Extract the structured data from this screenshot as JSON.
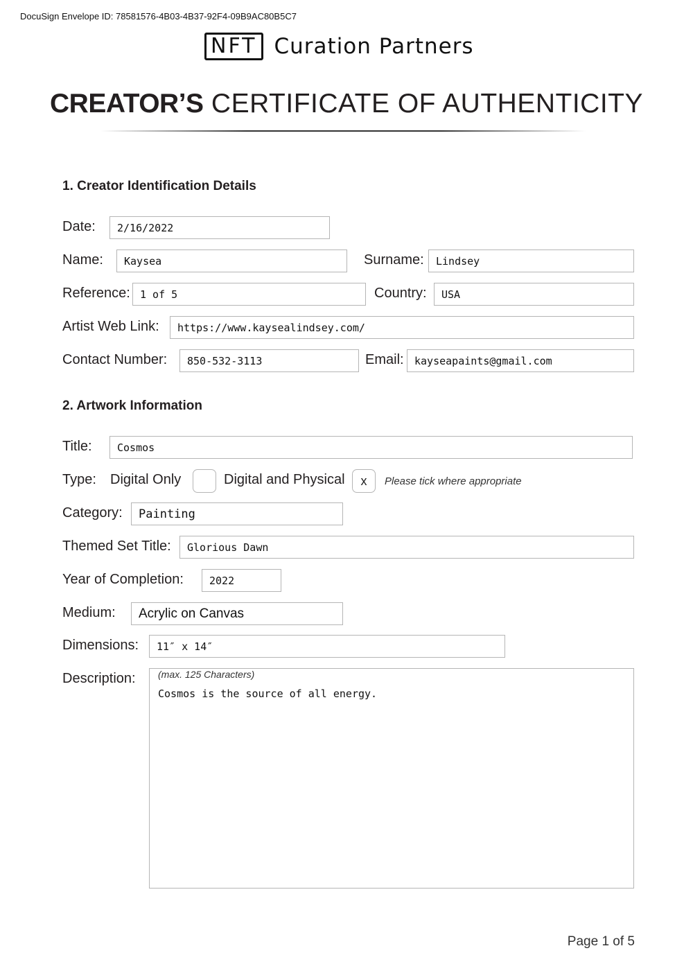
{
  "envelope_id": "DocuSign Envelope ID: 78581576-4B03-4B37-92F4-09B9AC80B5C7",
  "brand": {
    "logo_box_text": "NFT",
    "logo_text": "Curation Partners"
  },
  "certificate": {
    "title_bold": "CREATOR’S",
    "title_rest": "CERTIFICATE OF AUTHENTICITY"
  },
  "section1": {
    "heading": "1. Creator Identification Details",
    "date": {
      "label": "Date:",
      "value": "2/16/2022"
    },
    "name": {
      "label": "Name:",
      "value": "Kaysea"
    },
    "surname": {
      "label": "Surname:",
      "value": "Lindsey"
    },
    "reference": {
      "label": "Reference:",
      "value": "1 of 5"
    },
    "country": {
      "label": "Country:",
      "value": "USA"
    },
    "web_link": {
      "label": "Artist Web Link:",
      "value": "https://www.kaysealindsey.com/"
    },
    "contact": {
      "label": "Contact Number:",
      "value": "850-532-3113"
    },
    "email": {
      "label": "Email:",
      "value": "kayseapaints@gmail.com"
    }
  },
  "section2": {
    "heading": "2. Artwork Information",
    "title": {
      "label": "Title:",
      "value": "Cosmos"
    },
    "type": {
      "label": "Type:",
      "options": [
        {
          "label": "Digital Only",
          "mark": ""
        },
        {
          "label": "Digital and Physical",
          "mark": "x"
        }
      ],
      "hint": "Please tick where appropriate"
    },
    "category": {
      "label": "Category:",
      "value": "Painting"
    },
    "themed_set": {
      "label": "Themed Set Title:",
      "value": "Glorious Dawn"
    },
    "year": {
      "label": "Year of Completion:",
      "value": "2022"
    },
    "medium": {
      "label": "Medium:",
      "value": "Acrylic on Canvas"
    },
    "dimensions": {
      "label": "Dimensions:",
      "value": "11″ x 14″"
    },
    "description": {
      "label": "Description:",
      "hint": "(max. 125 Characters)",
      "value": "Cosmos is the source of all energy."
    }
  },
  "footer": {
    "page": "Page 1 of 5"
  }
}
